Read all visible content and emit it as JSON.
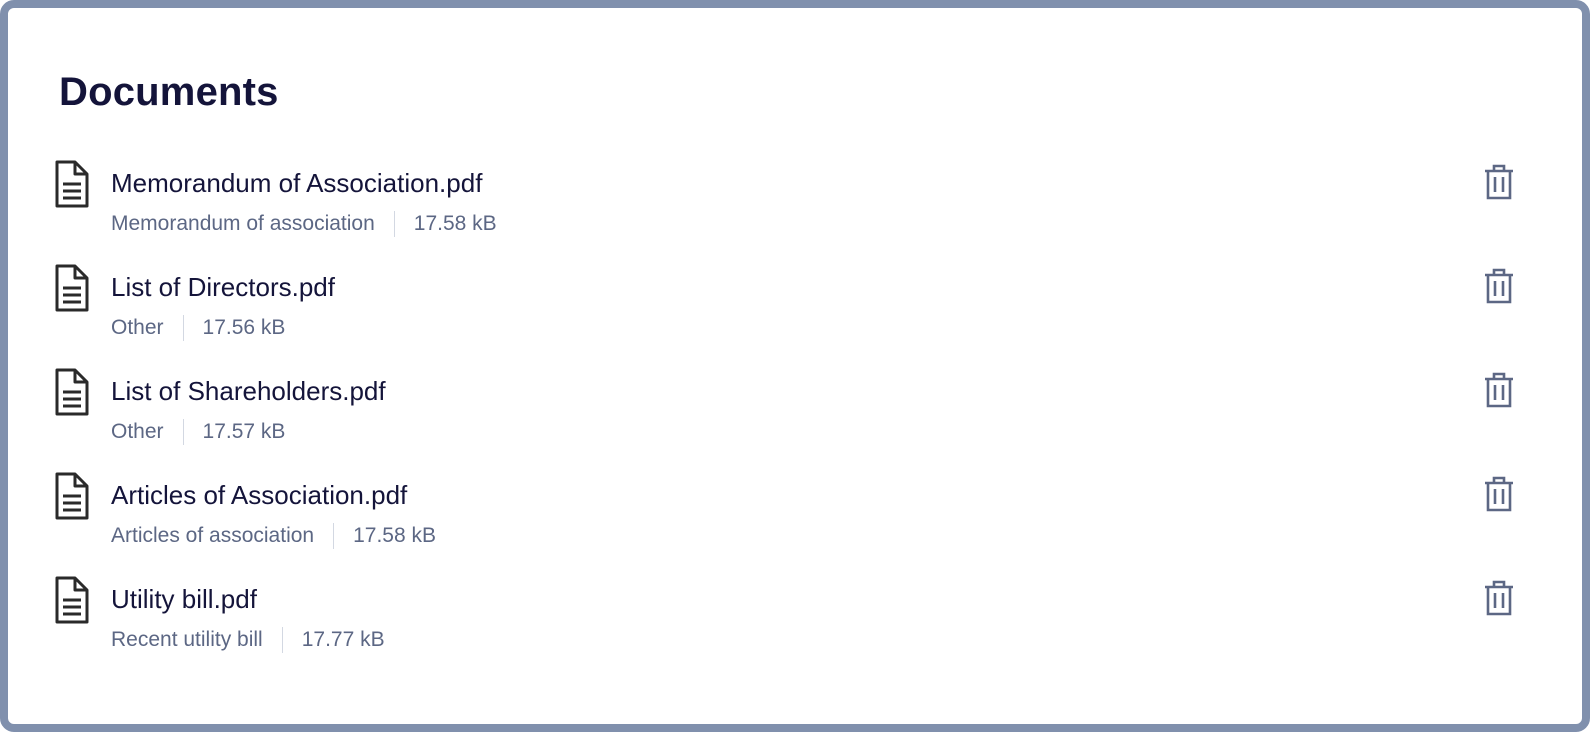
{
  "panel": {
    "title": "Documents"
  },
  "documents": [
    {
      "name": "Memorandum of Association.pdf",
      "category": "Memorandum of association",
      "size": "17.58 kB",
      "icon": "file-icon",
      "action_icon": "trash-icon"
    },
    {
      "name": "List of Directors.pdf",
      "category": "Other",
      "size": "17.56 kB",
      "icon": "file-icon",
      "action_icon": "trash-icon"
    },
    {
      "name": "List of Shareholders.pdf",
      "category": "Other",
      "size": "17.57 kB",
      "icon": "file-icon",
      "action_icon": "trash-icon"
    },
    {
      "name": "Articles of Association.pdf",
      "category": "Articles of association",
      "size": "17.58 kB",
      "icon": "file-icon",
      "action_icon": "trash-icon"
    },
    {
      "name": "Utility bill.pdf",
      "category": "Recent utility bill",
      "size": "17.77 kB",
      "icon": "file-icon",
      "action_icon": "trash-icon"
    }
  ],
  "colors": {
    "frame_border": "#8090ad",
    "title": "#14143a",
    "file_name": "#14143a",
    "meta_text": "#5c6784",
    "divider": "#d3d8e2",
    "file_icon": "#2a2a2a",
    "trash_icon": "#5c6784"
  }
}
